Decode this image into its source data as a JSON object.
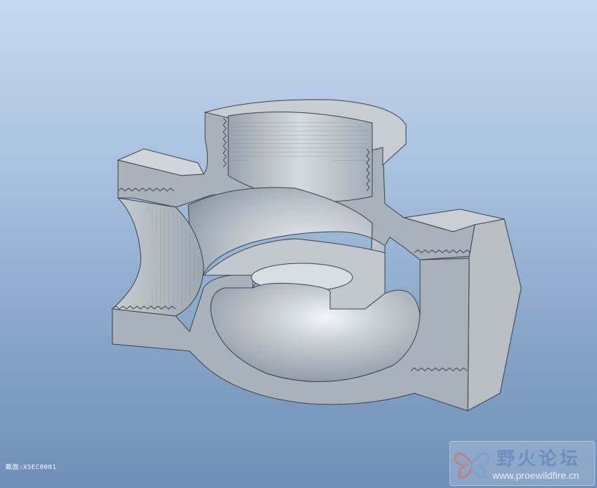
{
  "viewport": {
    "background_top": "#c6d9ee",
    "background_bottom": "#6f8fb8"
  },
  "model": {
    "body_color": "#c2c8cd",
    "cut_face_color": "#a3abb3",
    "shadow_color": "#7d868f",
    "highlight_color": "#f2f5f8"
  },
  "section": {
    "label": "截面:XSEC0001"
  },
  "watermark": {
    "title": "野火论坛",
    "url": "www.proewildfire.cn",
    "logo_icon": "butterfly-logo-icon"
  }
}
